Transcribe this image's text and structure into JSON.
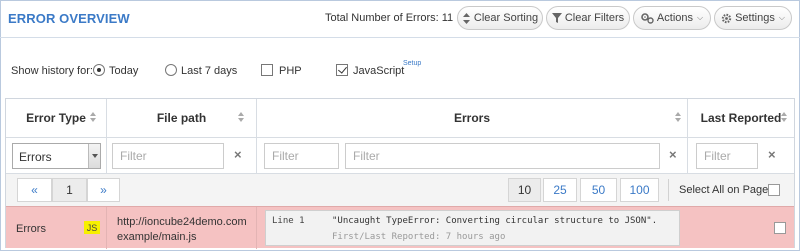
{
  "header": {
    "title": "ERROR OVERVIEW",
    "total_label": "Total Number of Errors: 11",
    "buttons": {
      "clear_sorting": "Clear Sorting",
      "clear_filters": "Clear Filters",
      "actions": "Actions",
      "settings": "Settings"
    }
  },
  "history": {
    "label": "Show history for:",
    "options": [
      "Today",
      "Last 7 days"
    ],
    "selected": "Today",
    "php_label": "PHP",
    "php_checked": false,
    "js_label": "JavaScript",
    "js_checked": true,
    "setup_link": "Setup"
  },
  "table": {
    "columns": {
      "error_type": "Error Type",
      "file_path": "File path",
      "errors": "Errors",
      "last_reported": "Last Reported"
    },
    "filters": {
      "type_select_value": "Errors",
      "placeholder": "Filter"
    },
    "pager": {
      "prev": "«",
      "current_page": "1",
      "next": "»",
      "page_sizes": [
        "10",
        "25",
        "50",
        "100"
      ],
      "active_size": "10",
      "select_all_label": "Select All on Page"
    },
    "rows": [
      {
        "type": "Errors",
        "lang_badge": "JS",
        "file_path_line1": "http://ioncube24demo.com",
        "file_path_line2": "example/main.js",
        "line": "Line 1",
        "message": "\"Uncaught TypeError: Converting circular structure to JSON\".",
        "meta": "First/Last Reported: 7 hours ago"
      }
    ]
  },
  "colors": {
    "accent": "#3b7ac7",
    "error_row": "#f5c2c2",
    "js_badge": "#f7f000"
  }
}
